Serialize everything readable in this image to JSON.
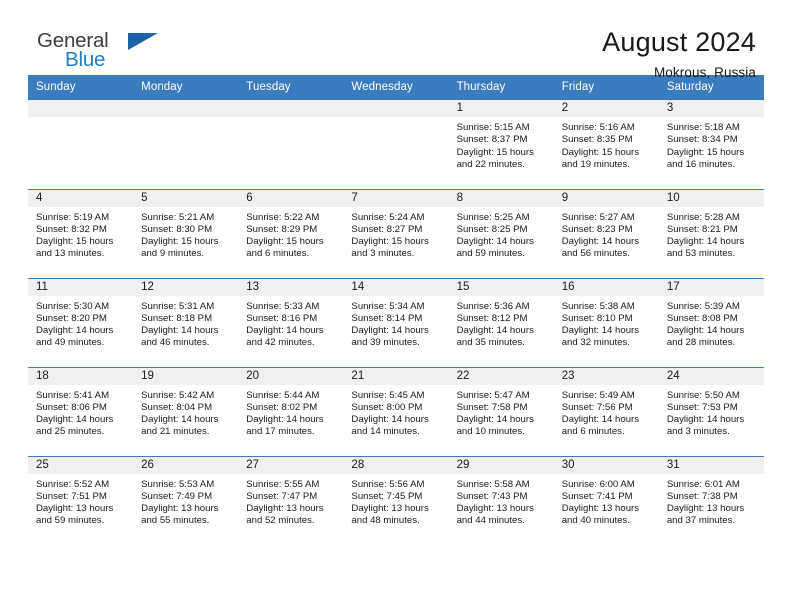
{
  "brand": {
    "name_part1": "General",
    "name_part2": "Blue",
    "triangle_color": "#1a63a8",
    "blue_color": "#1f7dc4"
  },
  "header": {
    "title": "August 2024",
    "subtitle": "Mokrous, Russia"
  },
  "theme": {
    "header_bg": "#3b7cbf",
    "header_text": "#ffffff",
    "daynum_band_bg": "#f0f0f0",
    "cell_bg": "#ffffff",
    "grid_line": "#3b7cbf"
  },
  "weekday_headers": [
    "Sunday",
    "Monday",
    "Tuesday",
    "Wednesday",
    "Thursday",
    "Friday",
    "Saturday"
  ],
  "weeks": [
    [
      {
        "day": "",
        "sunrise": "",
        "sunset": "",
        "daylight_1": "",
        "daylight_2": ""
      },
      {
        "day": "",
        "sunrise": "",
        "sunset": "",
        "daylight_1": "",
        "daylight_2": ""
      },
      {
        "day": "",
        "sunrise": "",
        "sunset": "",
        "daylight_1": "",
        "daylight_2": ""
      },
      {
        "day": "",
        "sunrise": "",
        "sunset": "",
        "daylight_1": "",
        "daylight_2": ""
      },
      {
        "day": "1",
        "sunrise": "Sunrise: 5:15 AM",
        "sunset": "Sunset: 8:37 PM",
        "daylight_1": "Daylight: 15 hours",
        "daylight_2": "and 22 minutes."
      },
      {
        "day": "2",
        "sunrise": "Sunrise: 5:16 AM",
        "sunset": "Sunset: 8:35 PM",
        "daylight_1": "Daylight: 15 hours",
        "daylight_2": "and 19 minutes."
      },
      {
        "day": "3",
        "sunrise": "Sunrise: 5:18 AM",
        "sunset": "Sunset: 8:34 PM",
        "daylight_1": "Daylight: 15 hours",
        "daylight_2": "and 16 minutes."
      }
    ],
    [
      {
        "day": "4",
        "sunrise": "Sunrise: 5:19 AM",
        "sunset": "Sunset: 8:32 PM",
        "daylight_1": "Daylight: 15 hours",
        "daylight_2": "and 13 minutes."
      },
      {
        "day": "5",
        "sunrise": "Sunrise: 5:21 AM",
        "sunset": "Sunset: 8:30 PM",
        "daylight_1": "Daylight: 15 hours",
        "daylight_2": "and 9 minutes."
      },
      {
        "day": "6",
        "sunrise": "Sunrise: 5:22 AM",
        "sunset": "Sunset: 8:29 PM",
        "daylight_1": "Daylight: 15 hours",
        "daylight_2": "and 6 minutes."
      },
      {
        "day": "7",
        "sunrise": "Sunrise: 5:24 AM",
        "sunset": "Sunset: 8:27 PM",
        "daylight_1": "Daylight: 15 hours",
        "daylight_2": "and 3 minutes."
      },
      {
        "day": "8",
        "sunrise": "Sunrise: 5:25 AM",
        "sunset": "Sunset: 8:25 PM",
        "daylight_1": "Daylight: 14 hours",
        "daylight_2": "and 59 minutes."
      },
      {
        "day": "9",
        "sunrise": "Sunrise: 5:27 AM",
        "sunset": "Sunset: 8:23 PM",
        "daylight_1": "Daylight: 14 hours",
        "daylight_2": "and 56 minutes."
      },
      {
        "day": "10",
        "sunrise": "Sunrise: 5:28 AM",
        "sunset": "Sunset: 8:21 PM",
        "daylight_1": "Daylight: 14 hours",
        "daylight_2": "and 53 minutes."
      }
    ],
    [
      {
        "day": "11",
        "sunrise": "Sunrise: 5:30 AM",
        "sunset": "Sunset: 8:20 PM",
        "daylight_1": "Daylight: 14 hours",
        "daylight_2": "and 49 minutes."
      },
      {
        "day": "12",
        "sunrise": "Sunrise: 5:31 AM",
        "sunset": "Sunset: 8:18 PM",
        "daylight_1": "Daylight: 14 hours",
        "daylight_2": "and 46 minutes."
      },
      {
        "day": "13",
        "sunrise": "Sunrise: 5:33 AM",
        "sunset": "Sunset: 8:16 PM",
        "daylight_1": "Daylight: 14 hours",
        "daylight_2": "and 42 minutes."
      },
      {
        "day": "14",
        "sunrise": "Sunrise: 5:34 AM",
        "sunset": "Sunset: 8:14 PM",
        "daylight_1": "Daylight: 14 hours",
        "daylight_2": "and 39 minutes."
      },
      {
        "day": "15",
        "sunrise": "Sunrise: 5:36 AM",
        "sunset": "Sunset: 8:12 PM",
        "daylight_1": "Daylight: 14 hours",
        "daylight_2": "and 35 minutes."
      },
      {
        "day": "16",
        "sunrise": "Sunrise: 5:38 AM",
        "sunset": "Sunset: 8:10 PM",
        "daylight_1": "Daylight: 14 hours",
        "daylight_2": "and 32 minutes."
      },
      {
        "day": "17",
        "sunrise": "Sunrise: 5:39 AM",
        "sunset": "Sunset: 8:08 PM",
        "daylight_1": "Daylight: 14 hours",
        "daylight_2": "and 28 minutes."
      }
    ],
    [
      {
        "day": "18",
        "sunrise": "Sunrise: 5:41 AM",
        "sunset": "Sunset: 8:06 PM",
        "daylight_1": "Daylight: 14 hours",
        "daylight_2": "and 25 minutes."
      },
      {
        "day": "19",
        "sunrise": "Sunrise: 5:42 AM",
        "sunset": "Sunset: 8:04 PM",
        "daylight_1": "Daylight: 14 hours",
        "daylight_2": "and 21 minutes."
      },
      {
        "day": "20",
        "sunrise": "Sunrise: 5:44 AM",
        "sunset": "Sunset: 8:02 PM",
        "daylight_1": "Daylight: 14 hours",
        "daylight_2": "and 17 minutes."
      },
      {
        "day": "21",
        "sunrise": "Sunrise: 5:45 AM",
        "sunset": "Sunset: 8:00 PM",
        "daylight_1": "Daylight: 14 hours",
        "daylight_2": "and 14 minutes."
      },
      {
        "day": "22",
        "sunrise": "Sunrise: 5:47 AM",
        "sunset": "Sunset: 7:58 PM",
        "daylight_1": "Daylight: 14 hours",
        "daylight_2": "and 10 minutes."
      },
      {
        "day": "23",
        "sunrise": "Sunrise: 5:49 AM",
        "sunset": "Sunset: 7:56 PM",
        "daylight_1": "Daylight: 14 hours",
        "daylight_2": "and 6 minutes."
      },
      {
        "day": "24",
        "sunrise": "Sunrise: 5:50 AM",
        "sunset": "Sunset: 7:53 PM",
        "daylight_1": "Daylight: 14 hours",
        "daylight_2": "and 3 minutes."
      }
    ],
    [
      {
        "day": "25",
        "sunrise": "Sunrise: 5:52 AM",
        "sunset": "Sunset: 7:51 PM",
        "daylight_1": "Daylight: 13 hours",
        "daylight_2": "and 59 minutes."
      },
      {
        "day": "26",
        "sunrise": "Sunrise: 5:53 AM",
        "sunset": "Sunset: 7:49 PM",
        "daylight_1": "Daylight: 13 hours",
        "daylight_2": "and 55 minutes."
      },
      {
        "day": "27",
        "sunrise": "Sunrise: 5:55 AM",
        "sunset": "Sunset: 7:47 PM",
        "daylight_1": "Daylight: 13 hours",
        "daylight_2": "and 52 minutes."
      },
      {
        "day": "28",
        "sunrise": "Sunrise: 5:56 AM",
        "sunset": "Sunset: 7:45 PM",
        "daylight_1": "Daylight: 13 hours",
        "daylight_2": "and 48 minutes."
      },
      {
        "day": "29",
        "sunrise": "Sunrise: 5:58 AM",
        "sunset": "Sunset: 7:43 PM",
        "daylight_1": "Daylight: 13 hours",
        "daylight_2": "and 44 minutes."
      },
      {
        "day": "30",
        "sunrise": "Sunrise: 6:00 AM",
        "sunset": "Sunset: 7:41 PM",
        "daylight_1": "Daylight: 13 hours",
        "daylight_2": "and 40 minutes."
      },
      {
        "day": "31",
        "sunrise": "Sunrise: 6:01 AM",
        "sunset": "Sunset: 7:38 PM",
        "daylight_1": "Daylight: 13 hours",
        "daylight_2": "and 37 minutes."
      }
    ]
  ]
}
